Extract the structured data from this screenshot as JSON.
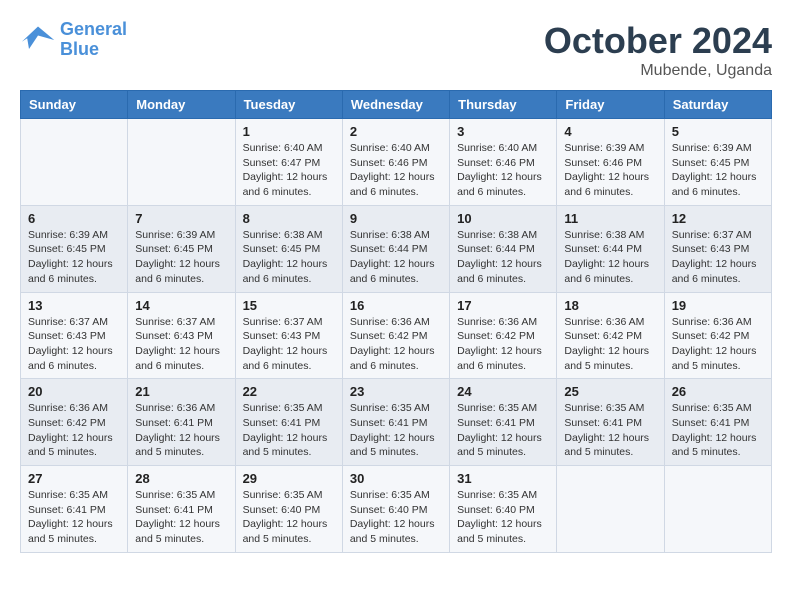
{
  "logo": {
    "text1": "General",
    "text2": "Blue"
  },
  "title": "October 2024",
  "location": "Mubende, Uganda",
  "weekdays": [
    "Sunday",
    "Monday",
    "Tuesday",
    "Wednesday",
    "Thursday",
    "Friday",
    "Saturday"
  ],
  "weeks": [
    [
      {
        "day": "",
        "info": ""
      },
      {
        "day": "",
        "info": ""
      },
      {
        "day": "1",
        "info": "Sunrise: 6:40 AM\nSunset: 6:47 PM\nDaylight: 12 hours and 6 minutes."
      },
      {
        "day": "2",
        "info": "Sunrise: 6:40 AM\nSunset: 6:46 PM\nDaylight: 12 hours and 6 minutes."
      },
      {
        "day": "3",
        "info": "Sunrise: 6:40 AM\nSunset: 6:46 PM\nDaylight: 12 hours and 6 minutes."
      },
      {
        "day": "4",
        "info": "Sunrise: 6:39 AM\nSunset: 6:46 PM\nDaylight: 12 hours and 6 minutes."
      },
      {
        "day": "5",
        "info": "Sunrise: 6:39 AM\nSunset: 6:45 PM\nDaylight: 12 hours and 6 minutes."
      }
    ],
    [
      {
        "day": "6",
        "info": "Sunrise: 6:39 AM\nSunset: 6:45 PM\nDaylight: 12 hours and 6 minutes."
      },
      {
        "day": "7",
        "info": "Sunrise: 6:39 AM\nSunset: 6:45 PM\nDaylight: 12 hours and 6 minutes."
      },
      {
        "day": "8",
        "info": "Sunrise: 6:38 AM\nSunset: 6:45 PM\nDaylight: 12 hours and 6 minutes."
      },
      {
        "day": "9",
        "info": "Sunrise: 6:38 AM\nSunset: 6:44 PM\nDaylight: 12 hours and 6 minutes."
      },
      {
        "day": "10",
        "info": "Sunrise: 6:38 AM\nSunset: 6:44 PM\nDaylight: 12 hours and 6 minutes."
      },
      {
        "day": "11",
        "info": "Sunrise: 6:38 AM\nSunset: 6:44 PM\nDaylight: 12 hours and 6 minutes."
      },
      {
        "day": "12",
        "info": "Sunrise: 6:37 AM\nSunset: 6:43 PM\nDaylight: 12 hours and 6 minutes."
      }
    ],
    [
      {
        "day": "13",
        "info": "Sunrise: 6:37 AM\nSunset: 6:43 PM\nDaylight: 12 hours and 6 minutes."
      },
      {
        "day": "14",
        "info": "Sunrise: 6:37 AM\nSunset: 6:43 PM\nDaylight: 12 hours and 6 minutes."
      },
      {
        "day": "15",
        "info": "Sunrise: 6:37 AM\nSunset: 6:43 PM\nDaylight: 12 hours and 6 minutes."
      },
      {
        "day": "16",
        "info": "Sunrise: 6:36 AM\nSunset: 6:42 PM\nDaylight: 12 hours and 6 minutes."
      },
      {
        "day": "17",
        "info": "Sunrise: 6:36 AM\nSunset: 6:42 PM\nDaylight: 12 hours and 6 minutes."
      },
      {
        "day": "18",
        "info": "Sunrise: 6:36 AM\nSunset: 6:42 PM\nDaylight: 12 hours and 5 minutes."
      },
      {
        "day": "19",
        "info": "Sunrise: 6:36 AM\nSunset: 6:42 PM\nDaylight: 12 hours and 5 minutes."
      }
    ],
    [
      {
        "day": "20",
        "info": "Sunrise: 6:36 AM\nSunset: 6:42 PM\nDaylight: 12 hours and 5 minutes."
      },
      {
        "day": "21",
        "info": "Sunrise: 6:36 AM\nSunset: 6:41 PM\nDaylight: 12 hours and 5 minutes."
      },
      {
        "day": "22",
        "info": "Sunrise: 6:35 AM\nSunset: 6:41 PM\nDaylight: 12 hours and 5 minutes."
      },
      {
        "day": "23",
        "info": "Sunrise: 6:35 AM\nSunset: 6:41 PM\nDaylight: 12 hours and 5 minutes."
      },
      {
        "day": "24",
        "info": "Sunrise: 6:35 AM\nSunset: 6:41 PM\nDaylight: 12 hours and 5 minutes."
      },
      {
        "day": "25",
        "info": "Sunrise: 6:35 AM\nSunset: 6:41 PM\nDaylight: 12 hours and 5 minutes."
      },
      {
        "day": "26",
        "info": "Sunrise: 6:35 AM\nSunset: 6:41 PM\nDaylight: 12 hours and 5 minutes."
      }
    ],
    [
      {
        "day": "27",
        "info": "Sunrise: 6:35 AM\nSunset: 6:41 PM\nDaylight: 12 hours and 5 minutes."
      },
      {
        "day": "28",
        "info": "Sunrise: 6:35 AM\nSunset: 6:41 PM\nDaylight: 12 hours and 5 minutes."
      },
      {
        "day": "29",
        "info": "Sunrise: 6:35 AM\nSunset: 6:40 PM\nDaylight: 12 hours and 5 minutes."
      },
      {
        "day": "30",
        "info": "Sunrise: 6:35 AM\nSunset: 6:40 PM\nDaylight: 12 hours and 5 minutes."
      },
      {
        "day": "31",
        "info": "Sunrise: 6:35 AM\nSunset: 6:40 PM\nDaylight: 12 hours and 5 minutes."
      },
      {
        "day": "",
        "info": ""
      },
      {
        "day": "",
        "info": ""
      }
    ]
  ]
}
